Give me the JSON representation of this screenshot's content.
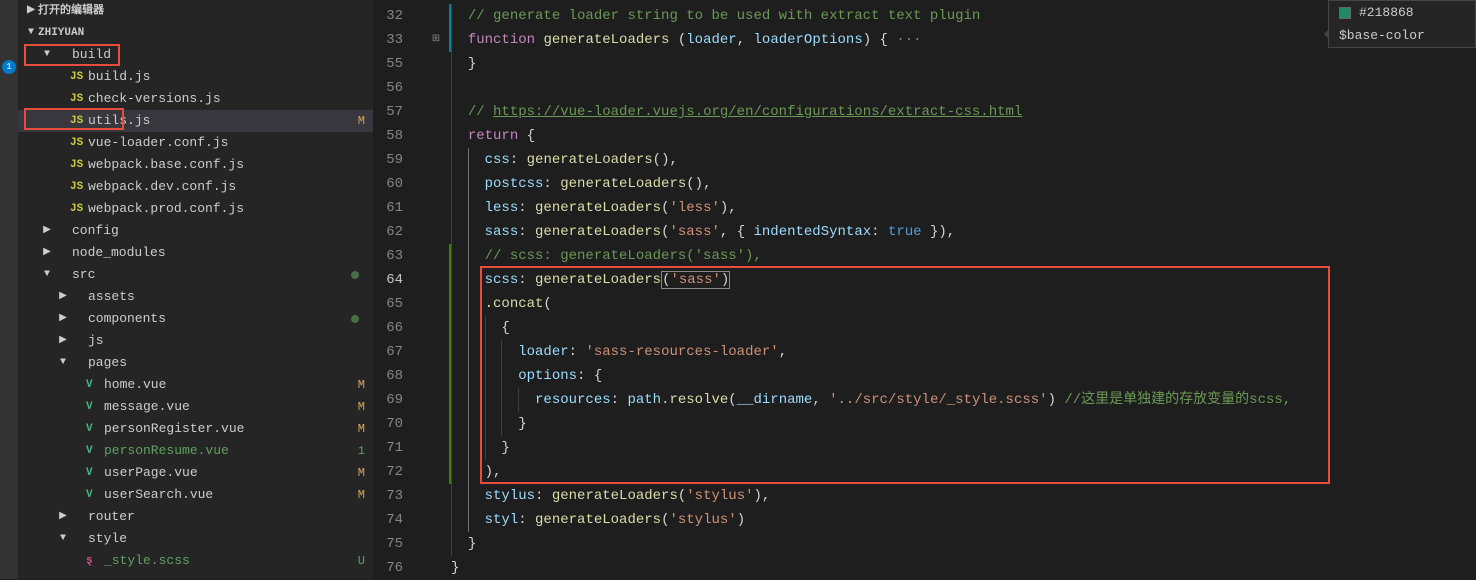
{
  "activity": {
    "badge": "1"
  },
  "sidebar": {
    "open_editors": "打开的编辑器",
    "project": "ZHIYUAN",
    "tree": [
      {
        "type": "folder",
        "name": "build",
        "expanded": true,
        "depth": 1,
        "red": true,
        "children": [
          {
            "type": "file",
            "name": "build.js",
            "icon": "js",
            "depth": 2
          },
          {
            "type": "file",
            "name": "check-versions.js",
            "icon": "js",
            "depth": 2
          },
          {
            "type": "file",
            "name": "utils.js",
            "icon": "js",
            "depth": 2,
            "status": "M",
            "selected": true,
            "red": true
          },
          {
            "type": "file",
            "name": "vue-loader.conf.js",
            "icon": "js",
            "depth": 2
          },
          {
            "type": "file",
            "name": "webpack.base.conf.js",
            "icon": "js",
            "depth": 2
          },
          {
            "type": "file",
            "name": "webpack.dev.conf.js",
            "icon": "js",
            "depth": 2
          },
          {
            "type": "file",
            "name": "webpack.prod.conf.js",
            "icon": "js",
            "depth": 2
          }
        ]
      },
      {
        "type": "folder",
        "name": "config",
        "expanded": false,
        "depth": 1
      },
      {
        "type": "folder",
        "name": "node_modules",
        "expanded": false,
        "depth": 1
      },
      {
        "type": "folder",
        "name": "src",
        "expanded": true,
        "depth": 1,
        "dot": true,
        "children": [
          {
            "type": "folder",
            "name": "assets",
            "expanded": false,
            "depth": 2
          },
          {
            "type": "folder",
            "name": "components",
            "expanded": false,
            "depth": 2,
            "dot": true
          },
          {
            "type": "folder",
            "name": "js",
            "expanded": false,
            "depth": 2
          },
          {
            "type": "folder",
            "name": "pages",
            "expanded": true,
            "depth": 2,
            "children": [
              {
                "type": "file",
                "name": "home.vue",
                "icon": "vue",
                "depth": 3,
                "status": "M"
              },
              {
                "type": "file",
                "name": "message.vue",
                "icon": "vue",
                "depth": 3,
                "status": "M"
              },
              {
                "type": "file",
                "name": "personRegister.vue",
                "icon": "vue",
                "depth": 3,
                "status": "M"
              },
              {
                "type": "file",
                "name": "personResume.vue",
                "icon": "vue",
                "depth": 3,
                "status": "1",
                "new": true
              },
              {
                "type": "file",
                "name": "userPage.vue",
                "icon": "vue",
                "depth": 3,
                "status": "M"
              },
              {
                "type": "file",
                "name": "userSearch.vue",
                "icon": "vue",
                "depth": 3,
                "status": "M"
              }
            ]
          },
          {
            "type": "folder",
            "name": "router",
            "expanded": false,
            "depth": 2
          },
          {
            "type": "folder",
            "name": "style",
            "expanded": true,
            "depth": 2,
            "children": [
              {
                "type": "file",
                "name": "_style.scss",
                "icon": "scss",
                "depth": 3,
                "status": "U",
                "new": true
              }
            ]
          }
        ]
      }
    ]
  },
  "editor": {
    "lines": [
      32,
      33,
      55,
      56,
      57,
      58,
      59,
      60,
      61,
      62,
      63,
      64,
      65,
      66,
      67,
      68,
      69,
      70,
      71,
      72,
      73,
      74,
      75,
      76
    ],
    "active_line": 64,
    "fold_on": [
      33
    ],
    "code": {
      "l32": "// generate loader string to be used with extract text plugin",
      "l33_kw": "function",
      "l33_fn": "generateLoaders",
      "l33_p1": "loader",
      "l33_p2": "loaderOptions",
      "l57_pre": "// ",
      "l57_url": "https://vue-loader.vuejs.org/en/configurations/extract-css.html",
      "l58_kw": "return",
      "l59_k": "css",
      "l59_fn": "generateLoaders",
      "l60_k": "postcss",
      "l60_fn": "generateLoaders",
      "l61_k": "less",
      "l61_fn": "generateLoaders",
      "l61_s": "'less'",
      "l62_k": "sass",
      "l62_fn": "generateLoaders",
      "l62_s": "'sass'",
      "l62_opt": "indentedSyntax",
      "l62_v": "true",
      "l63": "// scss: generateLoaders('sass'),",
      "l64_k": "scss",
      "l64_fn": "generateLoaders",
      "l64_s": "'sass'",
      "l65_fn": ".concat",
      "l67_k": "loader",
      "l67_s": "'sass-resources-loader'",
      "l68_k": "options",
      "l69_k": "resources",
      "l69_obj": "path",
      "l69_m": "resolve",
      "l69_a": "__dirname",
      "l69_s": "'../src/style/_style.scss'",
      "l69_c": "//这里是单独建的存放变量的scss,",
      "l73_k": "stylus",
      "l73_fn": "generateLoaders",
      "l73_s": "'stylus'",
      "l74_k": "styl",
      "l74_fn": "generateLoaders",
      "l74_s": "'stylus'"
    }
  },
  "hover": {
    "color": "#218868",
    "var": "$base-color"
  }
}
